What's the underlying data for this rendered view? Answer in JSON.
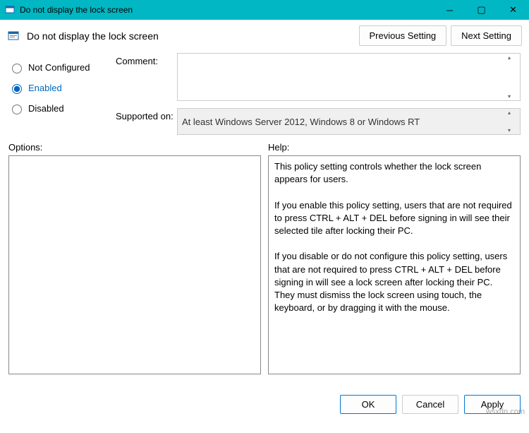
{
  "window": {
    "title": "Do not display the lock screen"
  },
  "header": {
    "policy_title": "Do not display the lock screen",
    "prev_button": "Previous Setting",
    "next_button": "Next Setting"
  },
  "state": {
    "not_configured": "Not Configured",
    "enabled": "Enabled",
    "disabled": "Disabled",
    "selected": "enabled"
  },
  "labels": {
    "comment": "Comment:",
    "supported_on": "Supported on:",
    "options": "Options:",
    "help": "Help:"
  },
  "fields": {
    "comment_value": "",
    "supported_on_value": "At least Windows Server 2012, Windows 8 or Windows RT"
  },
  "help_text": "This policy setting controls whether the lock screen appears for users.\n\nIf you enable this policy setting, users that are not required to press CTRL + ALT + DEL before signing in will see their selected tile after locking their PC.\n\nIf you disable or do not configure this policy setting, users that are not required to press CTRL + ALT + DEL before signing in will see a lock screen after locking their PC. They must dismiss the lock screen using touch, the keyboard, or by dragging it with the mouse.",
  "footer": {
    "ok": "OK",
    "cancel": "Cancel",
    "apply": "Apply"
  },
  "watermark": "wsxdn.com"
}
